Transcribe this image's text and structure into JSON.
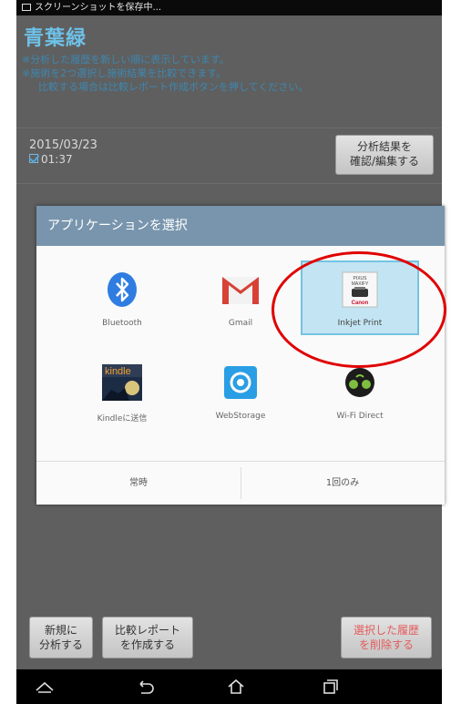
{
  "statusbar": {
    "text": "スクリーンショットを保存中..."
  },
  "screen": {
    "title": "青葉緑",
    "notes": [
      "※分析した履歴を新しい順に表示しています。",
      "※施術を2つ選択し施術結果を比較できます。",
      "比較する場合は比較レポート作成ボタンを押してください。"
    ],
    "history": {
      "date": "2015/03/23",
      "time": "01:37"
    },
    "result_button": [
      "分析結果を",
      "確認/編集する"
    ]
  },
  "dialog": {
    "title": "アプリケーションを選択",
    "apps": [
      {
        "label": "Bluetooth",
        "icon": "bluetooth-icon",
        "color": "#2f7de1"
      },
      {
        "label": "Gmail",
        "icon": "gmail-icon",
        "color": "#d74136"
      },
      {
        "label": "Inkjet Print",
        "icon": "canon-inkjet-print-icon",
        "selected": true
      },
      {
        "label": "Kindleに送信",
        "icon": "kindle-icon"
      },
      {
        "label": "WebStorage",
        "icon": "webstorage-icon",
        "color": "#2a9ee4"
      },
      {
        "label": "Wi-Fi Direct",
        "icon": "wifi-direct-icon",
        "color": "#7fbf3f"
      }
    ],
    "print_icon_text": {
      "line1": "PIXUS",
      "line2": "MAXIFY",
      "brand": "Canon"
    },
    "kindle_text": "kindle",
    "always_label": "常時",
    "once_label": "1回のみ"
  },
  "bottom": {
    "new_button": [
      "新規に",
      "分析する"
    ],
    "compare_button": [
      "比較レポート",
      "を作成する"
    ],
    "delete_button": [
      "選択した履歴",
      "を削除する"
    ]
  },
  "colors": {
    "accent": "#6ec1e8",
    "dialog_header": "#7895ad",
    "highlight": "#e00000"
  }
}
